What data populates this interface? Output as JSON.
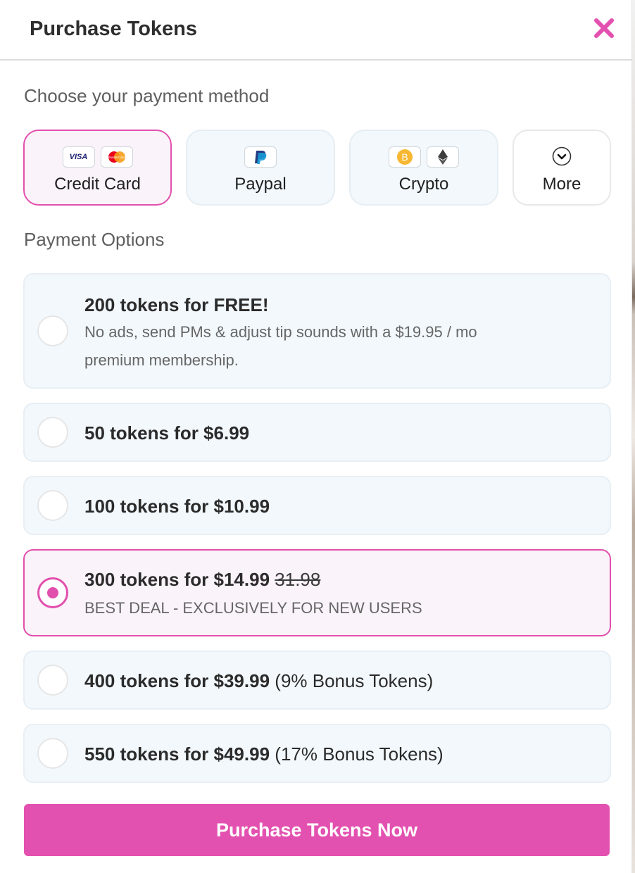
{
  "header": {
    "title": "Purchase Tokens"
  },
  "payment_method": {
    "label": "Choose your payment method",
    "methods": [
      {
        "label": "Credit Card",
        "selected": true,
        "icons": [
          "visa-icon",
          "mastercard-icon"
        ],
        "visa_text": "VISA",
        "mc_text": "MasterCard"
      },
      {
        "label": "Paypal",
        "selected": false,
        "icons": [
          "paypal-icon"
        ]
      },
      {
        "label": "Crypto",
        "selected": false,
        "icons": [
          "bitcoin-icon",
          "ethereum-icon"
        ]
      },
      {
        "label": "More",
        "selected": false,
        "icons": [
          "chevron-down-icon"
        ]
      }
    ]
  },
  "payment_options": {
    "label": "Payment Options",
    "options": [
      {
        "title": "200 tokens for FREE!",
        "subtitle_line1": "No ads, send PMs & adjust tip sounds with a $19.95 / mo",
        "subtitle_line2": "premium membership.",
        "selected": false
      },
      {
        "title": "50 tokens for $6.99",
        "selected": false
      },
      {
        "title": "100 tokens for $10.99",
        "selected": false
      },
      {
        "title": "300 tokens for $14.99",
        "old_price": "31.98",
        "subtitle": "BEST DEAL - EXCLUSIVELY FOR NEW USERS",
        "selected": true
      },
      {
        "title": "400 tokens for $39.99",
        "bonus": "(9% Bonus Tokens)",
        "selected": false
      },
      {
        "title": "550 tokens for $49.99",
        "bonus": "(17% Bonus Tokens)",
        "selected": false
      }
    ]
  },
  "purchase_button": {
    "label": "Purchase Tokens Now"
  },
  "colors": {
    "accent": "#e351b0",
    "option_bg": "#f2f8fc",
    "selected_bg": "#fbf3fa"
  }
}
